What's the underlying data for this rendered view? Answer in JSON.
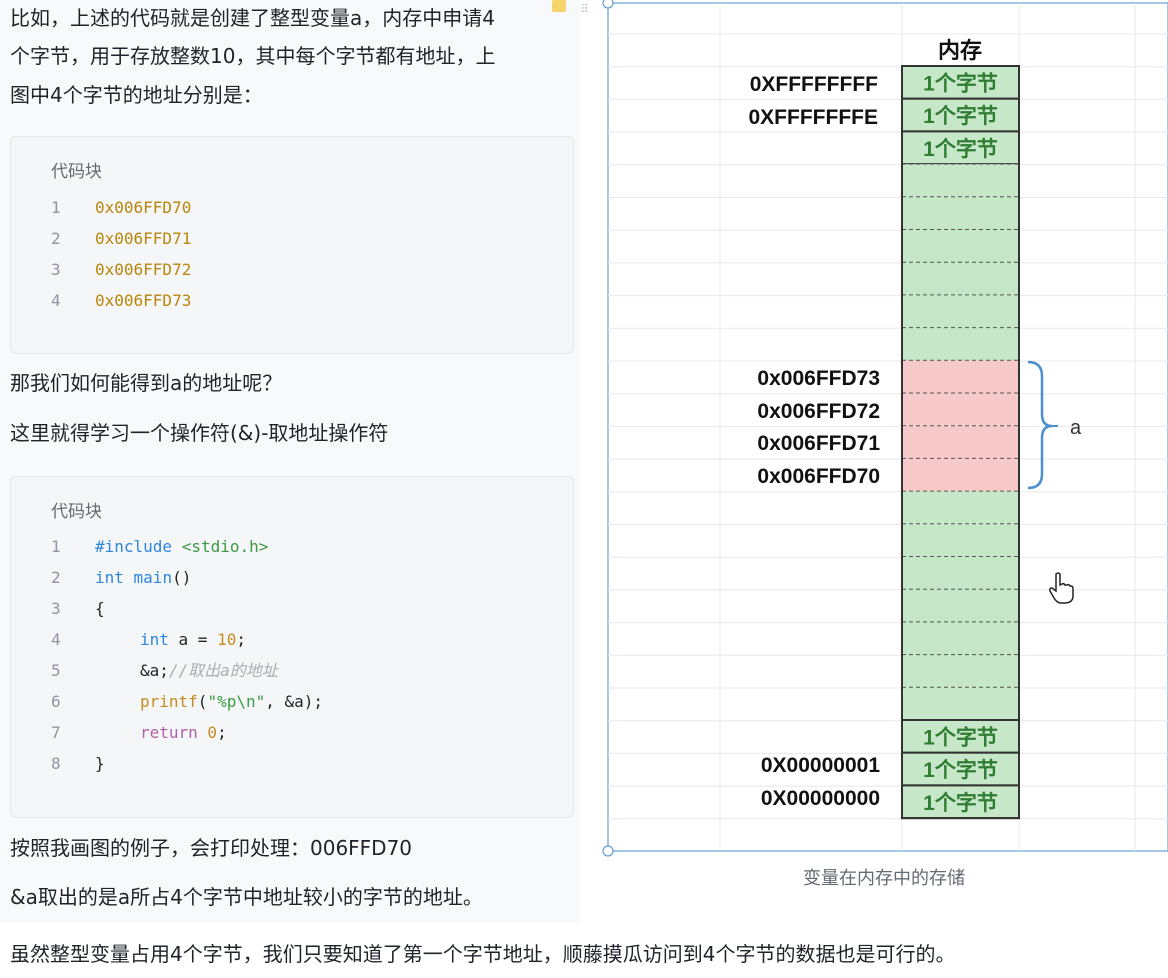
{
  "left": {
    "intro_lines": [
      "比如，上述的代码就是创建了整型变量a，内存中申请4",
      "个字节，用于存放整数10，其中每个字节都有地址，上",
      "图中4个字节的地址分别是："
    ],
    "codeblock1": {
      "title": "代码块",
      "lines": [
        {
          "n": "1",
          "text": "0x006FFD70"
        },
        {
          "n": "2",
          "text": "0x006FFD71"
        },
        {
          "n": "3",
          "text": "0x006FFD72"
        },
        {
          "n": "4",
          "text": "0x006FFD73"
        }
      ]
    },
    "question": "那我们如何能得到a的地址呢？",
    "explain": "这里就得学习一个操作符(&)-取地址操作符",
    "codeblock2": {
      "title": "代码块",
      "line_numbers": [
        "1",
        "2",
        "3",
        "4",
        "5",
        "6",
        "7",
        "8"
      ],
      "l1_kw": "#include",
      "l1_hdr": " <stdio.h>",
      "l2_type": "int",
      "l2_fn": " main",
      "l2_paren": "()",
      "l3": "{",
      "l4_type": "int",
      "l4_rest": " a = ",
      "l4_num": "10",
      "l4_end": ";",
      "l5_code": "&a;",
      "l5_cmt": "//取出a的地址",
      "l6_fn": "printf",
      "l6_open": "(",
      "l6_str": "\"%p\\n\"",
      "l6_rest": ", &a);",
      "l7_kw": "return",
      "l7_num": " 0",
      "l7_end": ";",
      "l8": "}"
    },
    "print_result": "按照我画图的例子，会打印处理：006FFD70",
    "note": "&a取出的是a所占4个字节中地址较小的字节的地址。"
  },
  "diagram": {
    "header": "内存",
    "cell_label": "1个字节",
    "top_addrs": [
      "0XFFFFFFFF",
      "0XFFFFFFFE"
    ],
    "a_addrs": [
      "0x006FFD73",
      "0x006FFD72",
      "0x006FFD71",
      "0x006FFD70"
    ],
    "bottom_addrs": [
      "0X00000001",
      "0X00000000"
    ],
    "brace_label": "a",
    "caption": "变量在内存中的存储",
    "colors": {
      "green": "#c6e7c8",
      "red": "#f8c9c9",
      "border": "#333333",
      "brace": "#4a8fcf",
      "label_green": "#2e7d32"
    }
  },
  "bottom_text": "虽然整型变量占用4个字节，我们只要知道了第一个字节地址，顺藤摸瓜访问到4个字节的数据也是可行的。"
}
